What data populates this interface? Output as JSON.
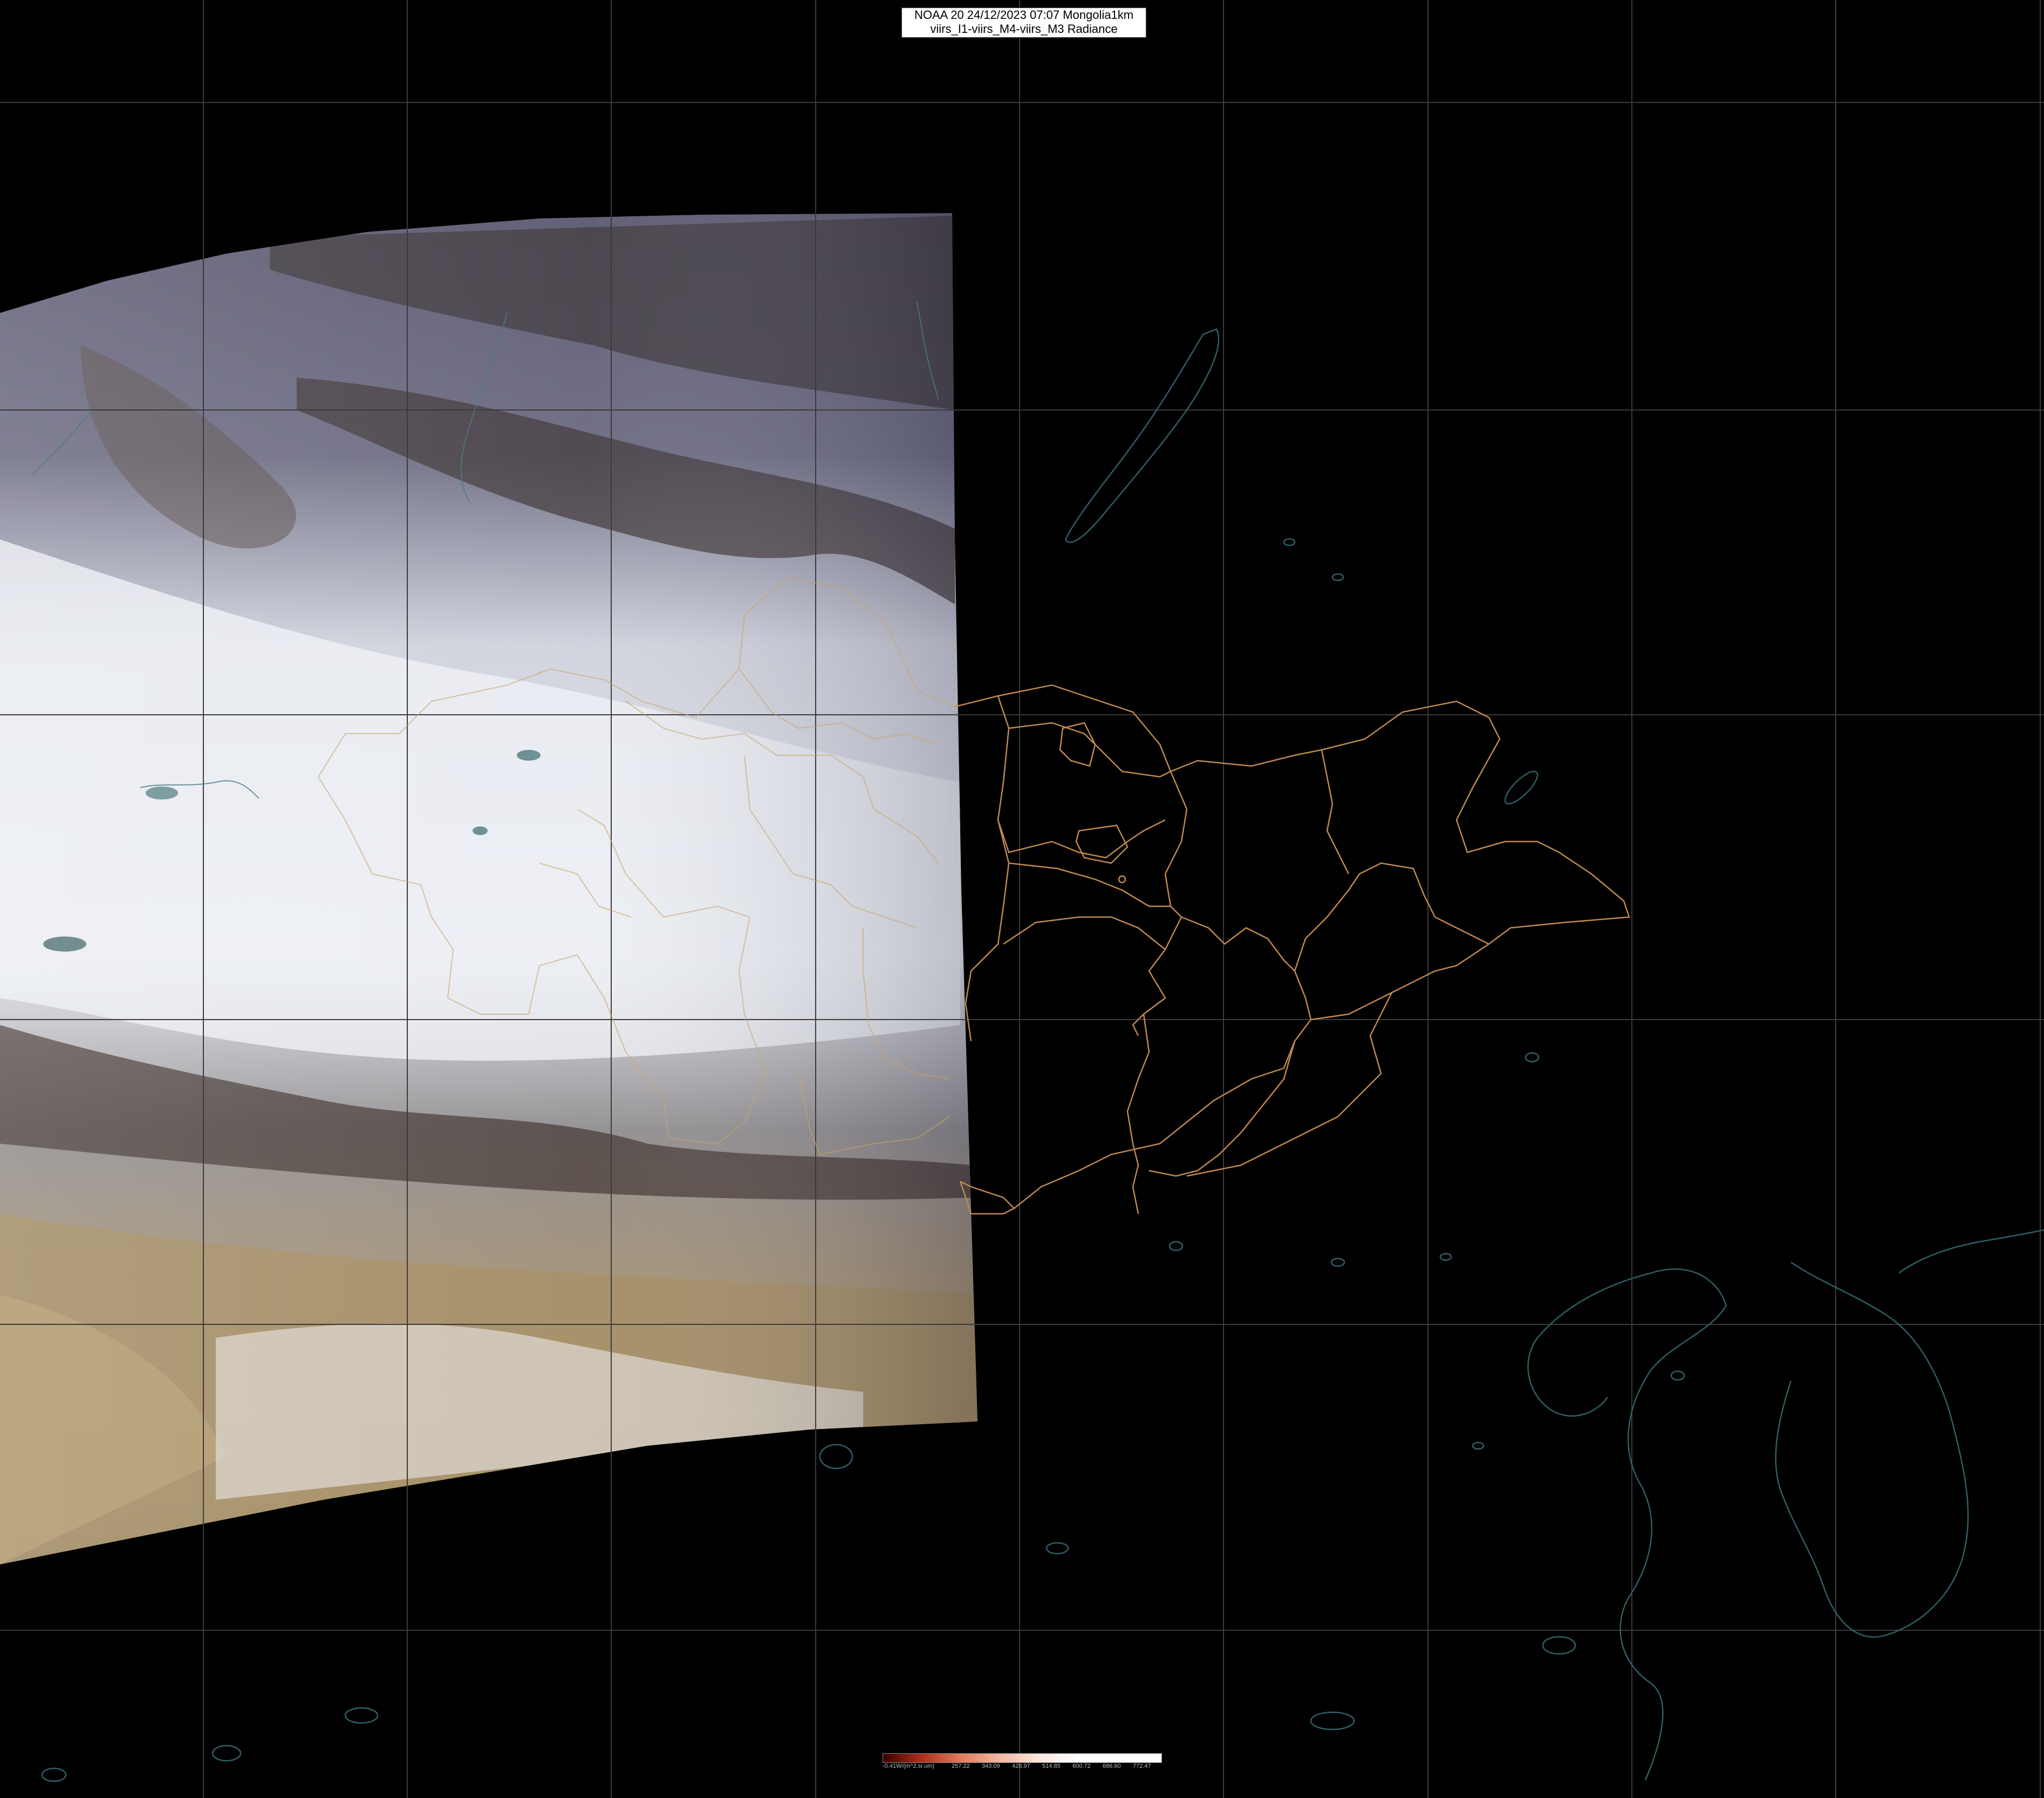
{
  "header": {
    "line1": "NOAA 20 24/12/2023 07:07 Mongolia1km",
    "line2": "viirs_I1-viirs_M4-viirs_M3 Radiance"
  },
  "legend": {
    "unit_label": "-0.41W/(m^2.sr.um)",
    "ticks": [
      "257.22",
      "343.09",
      "428.97",
      "514.85",
      "600.72",
      "686.60",
      "772.47"
    ],
    "colors": [
      "#3a0000",
      "#b0301c",
      "#e07b5c",
      "#f2b7a3",
      "#fbe6dc",
      "#ffffff"
    ]
  },
  "colors": {
    "background": "#000000",
    "grid": "#3a3a3a",
    "coastline": "#2f5f66",
    "boundary": "#c08a4e",
    "swath_snow": "#dfe2ea",
    "swath_mountain": "#3a3236",
    "swath_desert": "#a08a64"
  }
}
